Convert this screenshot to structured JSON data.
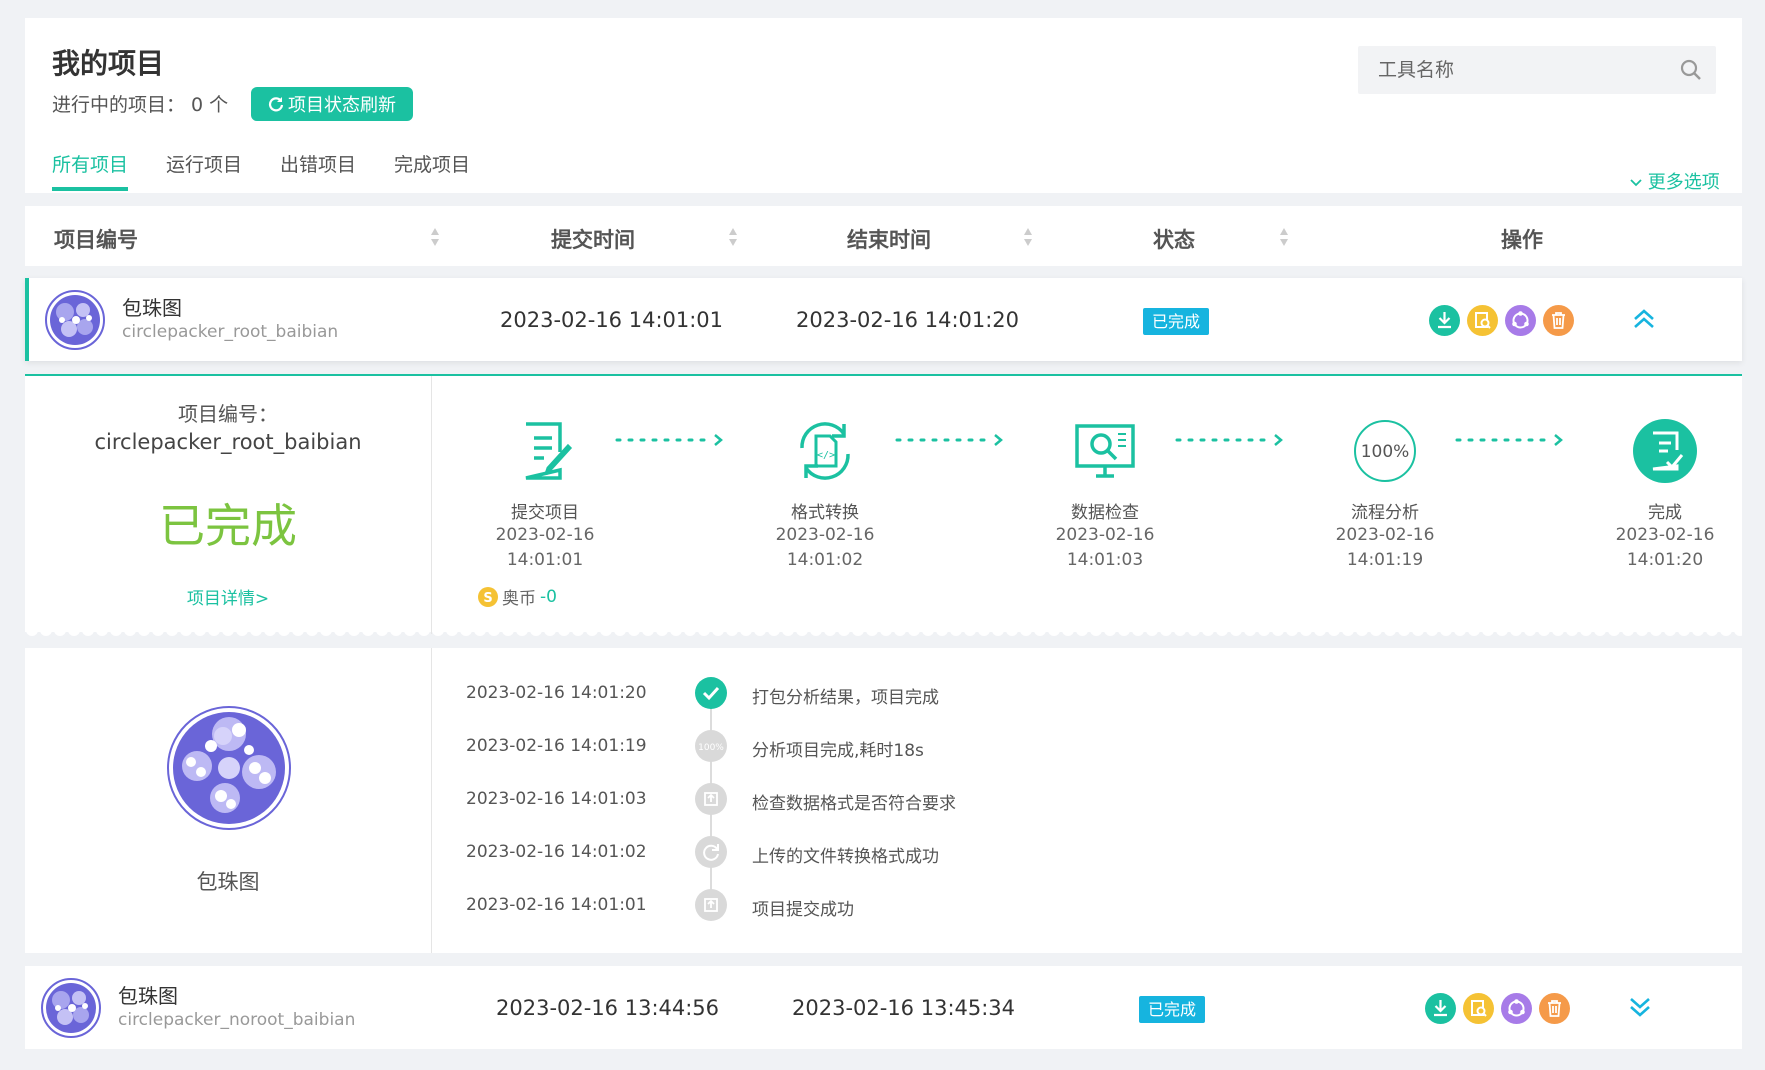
{
  "header": {
    "title": "我的项目",
    "running_label": "进行中的项目：",
    "running_count": "0 个",
    "refresh_label": "项目状态刷新",
    "search_placeholder": "工具名称",
    "more_options": "更多选项",
    "tabs": [
      {
        "label": "所有项目",
        "active": true
      },
      {
        "label": "运行项目",
        "active": false
      },
      {
        "label": "出错项目",
        "active": false
      },
      {
        "label": "完成项目",
        "active": false
      }
    ]
  },
  "table": {
    "columns": [
      "项目编号",
      "提交时间",
      "结束时间",
      "状态",
      "操作"
    ],
    "rows": [
      {
        "name": "包珠图",
        "id": "circlepacker_root_baibian",
        "submit": "2023-02-16 14:01:01",
        "end": "2023-02-16 14:01:20",
        "status": "已完成",
        "expanded": true
      },
      {
        "name": "包珠图",
        "id": "circlepacker_noroot_baibian",
        "submit": "2023-02-16 13:44:56",
        "end": "2023-02-16 13:45:34",
        "status": "已完成",
        "expanded": false
      }
    ]
  },
  "detail": {
    "label": "项目编号：",
    "id": "circlepacker_root_baibian",
    "status": "已完成",
    "link": "项目详情>",
    "coin_label": "奥币",
    "coin_delta": "-0",
    "progress_text": "100%",
    "steps": [
      {
        "name": "提交项目",
        "date": "2023-02-16",
        "time": "14:01:01",
        "icon": "document-edit-icon"
      },
      {
        "name": "格式转换",
        "date": "2023-02-16",
        "time": "14:01:02",
        "icon": "format-convert-icon"
      },
      {
        "name": "数据检查",
        "date": "2023-02-16",
        "time": "14:01:03",
        "icon": "data-check-icon"
      },
      {
        "name": "流程分析",
        "date": "2023-02-16",
        "time": "14:01:19",
        "icon": "progress-100-icon"
      },
      {
        "name": "完成",
        "date": "2023-02-16",
        "time": "14:01:20",
        "icon": "complete-icon"
      }
    ]
  },
  "log": {
    "name": "包珠图",
    "entries": [
      {
        "time": "2023-02-16 14:01:20",
        "text": "打包分析结果，项目完成",
        "icon": "check-icon"
      },
      {
        "time": "2023-02-16 14:01:19",
        "text": "分析项目完成,耗时18s",
        "icon": "progress-100-icon"
      },
      {
        "time": "2023-02-16 14:01:03",
        "text": "检查数据格式是否符合要求",
        "icon": "upload-icon"
      },
      {
        "time": "2023-02-16 14:01:02",
        "text": "上传的文件转换格式成功",
        "icon": "refresh-icon"
      },
      {
        "time": "2023-02-16 14:01:01",
        "text": "项目提交成功",
        "icon": "upload-icon"
      }
    ]
  },
  "colors": {
    "accent": "#1bc1a1",
    "badge": "#16b4df",
    "done_text": "#7cc440",
    "purple": "#6a65d8"
  }
}
